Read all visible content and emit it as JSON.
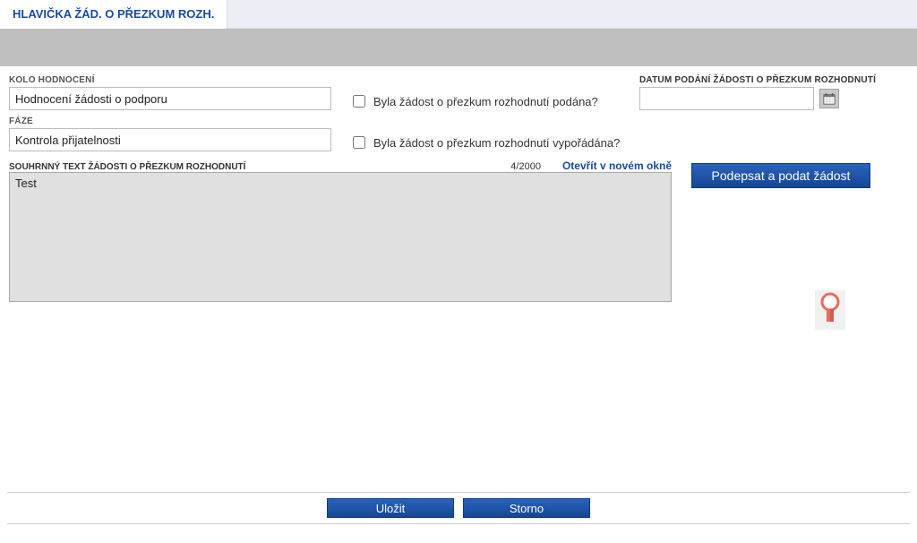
{
  "tab": {
    "title": "HLAVIČKA ŽÁD. O PŘEZKUM ROZH."
  },
  "labels": {
    "kolo": "KOLO HODNOCENÍ",
    "faze": "FÁZE",
    "datum": "DATUM PODÁNÍ ŽÁDOSTI O PŘEZKUM ROZHODNUTÍ",
    "souhrn": "SOUHRNNÝ TEXT ŽÁDOSTI O PŘEZKUM ROZHODNUTÍ"
  },
  "fields": {
    "kolo": "Hodnocení žádosti o podporu",
    "faze": "Kontrola přijatelnosti",
    "datum": "",
    "souhrn": "Test"
  },
  "checks": {
    "podana_label": "Byla žádost o přezkum rozhodnutí podána?",
    "vyporadana_label": "Byla žádost o přezkum rozhodnutí vypořádána?"
  },
  "summary": {
    "counter": "4/2000",
    "open_link": "Otevřít v novém okně"
  },
  "buttons": {
    "sign_submit": "Podepsat a podat žádost",
    "save": "Uložit",
    "cancel": "Storno"
  }
}
